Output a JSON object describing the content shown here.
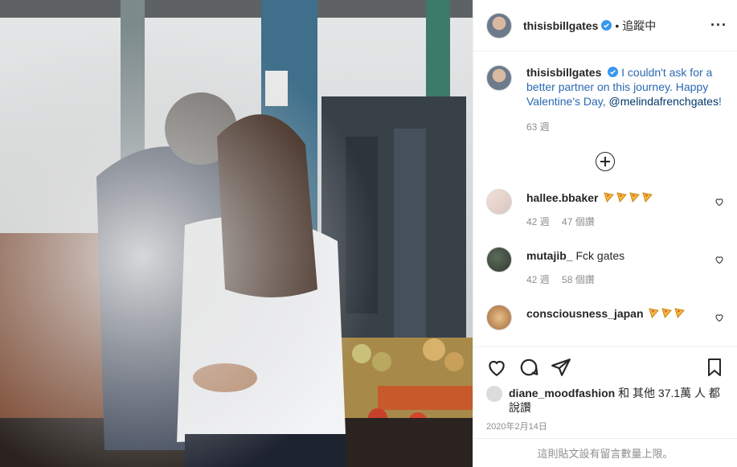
{
  "header": {
    "username": "thisisbillgates",
    "separator": "•",
    "follow_status": "追蹤中",
    "more_icon": "more-horizontal-icon"
  },
  "caption": {
    "username": "thisisbillgates",
    "text": "I couldn't ask for a better partner on this journey. Happy Valentine's Day,",
    "mention": "@melindafrenchgates",
    "mention_suffix": "!",
    "time": "63 週"
  },
  "load_more_icon": "plus-circle-icon",
  "comments": [
    {
      "username": "hallee.bbaker",
      "text": "",
      "emoji": "pizza-emoji x4",
      "time": "42 週",
      "likes": "47 個讚"
    },
    {
      "username": "mutajib_",
      "text": "Fck gates",
      "time": "42 週",
      "likes": "58 個讚"
    },
    {
      "username": "consciousness_japan",
      "text": "",
      "emoji": "pizza-emoji x3"
    }
  ],
  "actions": {
    "like_icon": "heart-icon",
    "comment_icon": "comment-icon",
    "share_icon": "send-icon",
    "save_icon": "bookmark-icon"
  },
  "liked_by": {
    "username": "diane_moodfashion",
    "text": "和 其他 37.1萬 人 都說讚"
  },
  "date": "2020年2月14日",
  "footer": "這則貼文設有留言數量上限。",
  "colors": {
    "verified": "#3897f0",
    "link": "#00376b",
    "muted": "#8e8e8e",
    "border": "#efefef"
  }
}
